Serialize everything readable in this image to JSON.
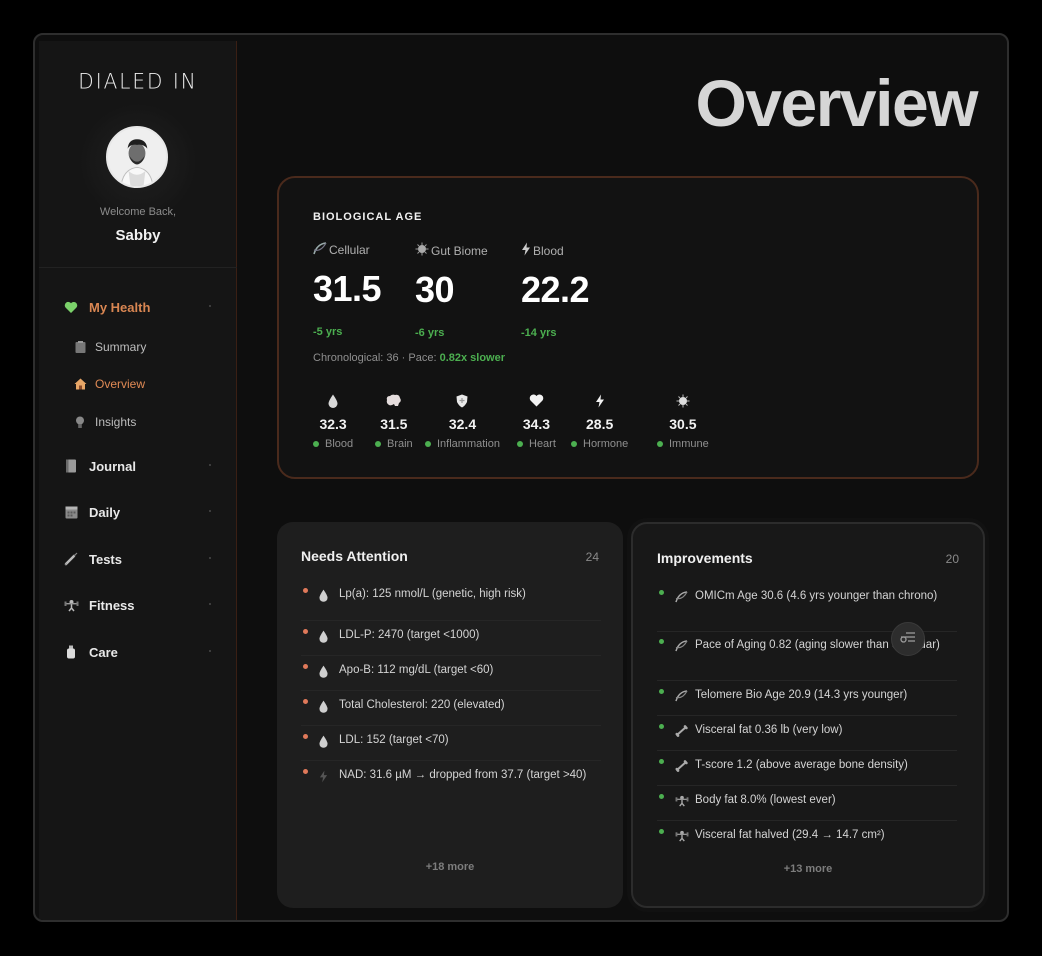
{
  "sidebar": {
    "brand": "DIALED IN",
    "welcome": "Welcome Back,",
    "username": "Sabby",
    "nav": {
      "my_health": {
        "label": "My Health",
        "icon": "green-heart-icon"
      },
      "summary": {
        "label": "Summary",
        "icon": "clipboard-icon"
      },
      "overview": {
        "label": "Overview",
        "icon": "home-icon"
      },
      "insights": {
        "label": "Insights",
        "icon": "lightbulb-icon"
      },
      "journal": {
        "label": "Journal",
        "icon": "notebook-icon"
      },
      "daily": {
        "label": "Daily",
        "icon": "calendar-icon"
      },
      "tests": {
        "label": "Tests",
        "icon": "syringe-icon"
      },
      "fitness": {
        "label": "Fitness",
        "icon": "dumbbell-icon"
      },
      "care": {
        "label": "Care",
        "icon": "bottle-icon"
      }
    }
  },
  "main": {
    "title": "Overview",
    "bio_age": {
      "heading": "BIOLOGICAL AGE",
      "metrics": [
        {
          "label": "Cellular",
          "value": "31.5",
          "delta": "-5 yrs",
          "icon": "dna-icon"
        },
        {
          "label": "Gut Biome",
          "value": "30",
          "delta": "-6 yrs",
          "icon": "microbe-icon"
        },
        {
          "label": "Blood",
          "value": "22.2",
          "delta": "-14 yrs",
          "icon": "bolt-icon"
        }
      ],
      "chrono_prefix": "Chronological: 36 · Pace: ",
      "chrono_pace": "0.82x slower",
      "systems": [
        {
          "label": "Blood",
          "value": "32.3",
          "icon": "drop-icon"
        },
        {
          "label": "Brain",
          "value": "31.5",
          "icon": "brain-icon"
        },
        {
          "label": "Inflammation",
          "value": "32.4",
          "icon": "shield-icon"
        },
        {
          "label": "Heart",
          "value": "34.3",
          "icon": "heart-icon"
        },
        {
          "label": "Hormone",
          "value": "28.5",
          "icon": "bolt-icon"
        },
        {
          "label": "Immune",
          "value": "30.5",
          "icon": "microbe-icon"
        }
      ]
    },
    "needs_attention": {
      "title": "Needs Attention",
      "count": "24",
      "items": [
        {
          "text": "Lp(a): 125 nmol/L (genetic, high risk)",
          "icon": "drop-icon"
        },
        {
          "text": "LDL-P: 2470 (target <1000)",
          "icon": "drop-icon"
        },
        {
          "text": "Apo-B: 112 mg/dL (target <60)",
          "icon": "drop-icon"
        },
        {
          "text": "Total Cholesterol: 220 (elevated)",
          "icon": "drop-icon"
        },
        {
          "text": "LDL: 152 (target <70)",
          "icon": "drop-icon"
        },
        {
          "text": "NAD: 31.6 µM → dropped from 37.7 (target >40)",
          "icon": "bolt-icon"
        }
      ],
      "more": "+18 more"
    },
    "improvements": {
      "title": "Improvements",
      "count": "20",
      "items": [
        {
          "text": "OMICm Age 30.6 (4.6 yrs younger than chrono)",
          "icon": "dna-icon"
        },
        {
          "text": "Pace of Aging 0.82 (aging slower than calendar)",
          "icon": "dna-icon"
        },
        {
          "text": "Telomere Bio Age 20.9 (14.3 yrs younger)",
          "icon": "dna-icon"
        },
        {
          "text": "Visceral fat 0.36 lb (very low)",
          "icon": "bone-icon"
        },
        {
          "text": "T-score 1.2 (above average bone density)",
          "icon": "bone-icon"
        },
        {
          "text": "Body fat 8.0% (lowest ever)",
          "icon": "dumbbell-icon"
        },
        {
          "text": "Visceral fat halved (29.4 → 14.7 cm²)",
          "icon": "dumbbell-icon"
        }
      ],
      "more": "+13 more"
    }
  },
  "colors": {
    "accent": "#d98652",
    "positive": "#4caf50",
    "warning": "#e0795a"
  }
}
